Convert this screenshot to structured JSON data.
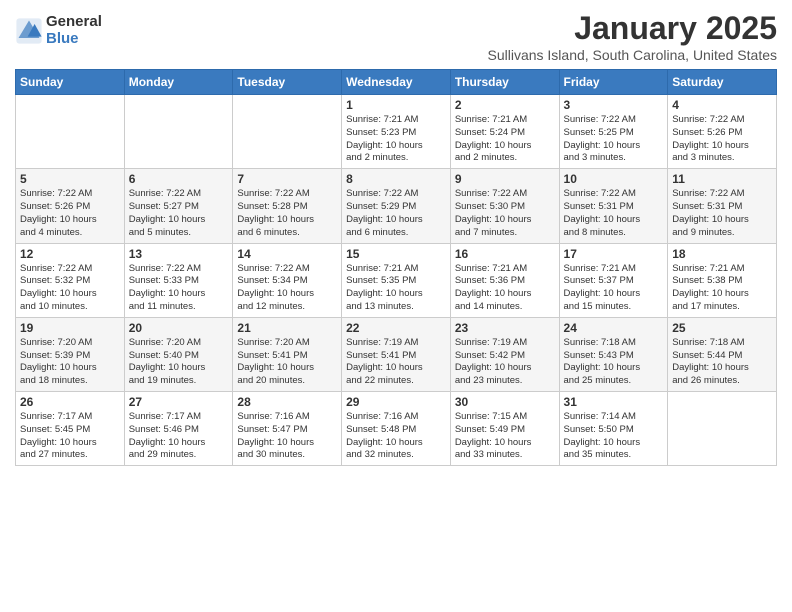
{
  "logo": {
    "general": "General",
    "blue": "Blue"
  },
  "title": "January 2025",
  "subtitle": "Sullivans Island, South Carolina, United States",
  "weekdays": [
    "Sunday",
    "Monday",
    "Tuesday",
    "Wednesday",
    "Thursday",
    "Friday",
    "Saturday"
  ],
  "weeks": [
    [
      {
        "day": "",
        "info": ""
      },
      {
        "day": "",
        "info": ""
      },
      {
        "day": "",
        "info": ""
      },
      {
        "day": "1",
        "info": "Sunrise: 7:21 AM\nSunset: 5:23 PM\nDaylight: 10 hours\nand 2 minutes."
      },
      {
        "day": "2",
        "info": "Sunrise: 7:21 AM\nSunset: 5:24 PM\nDaylight: 10 hours\nand 2 minutes."
      },
      {
        "day": "3",
        "info": "Sunrise: 7:22 AM\nSunset: 5:25 PM\nDaylight: 10 hours\nand 3 minutes."
      },
      {
        "day": "4",
        "info": "Sunrise: 7:22 AM\nSunset: 5:26 PM\nDaylight: 10 hours\nand 3 minutes."
      }
    ],
    [
      {
        "day": "5",
        "info": "Sunrise: 7:22 AM\nSunset: 5:26 PM\nDaylight: 10 hours\nand 4 minutes."
      },
      {
        "day": "6",
        "info": "Sunrise: 7:22 AM\nSunset: 5:27 PM\nDaylight: 10 hours\nand 5 minutes."
      },
      {
        "day": "7",
        "info": "Sunrise: 7:22 AM\nSunset: 5:28 PM\nDaylight: 10 hours\nand 6 minutes."
      },
      {
        "day": "8",
        "info": "Sunrise: 7:22 AM\nSunset: 5:29 PM\nDaylight: 10 hours\nand 6 minutes."
      },
      {
        "day": "9",
        "info": "Sunrise: 7:22 AM\nSunset: 5:30 PM\nDaylight: 10 hours\nand 7 minutes."
      },
      {
        "day": "10",
        "info": "Sunrise: 7:22 AM\nSunset: 5:31 PM\nDaylight: 10 hours\nand 8 minutes."
      },
      {
        "day": "11",
        "info": "Sunrise: 7:22 AM\nSunset: 5:31 PM\nDaylight: 10 hours\nand 9 minutes."
      }
    ],
    [
      {
        "day": "12",
        "info": "Sunrise: 7:22 AM\nSunset: 5:32 PM\nDaylight: 10 hours\nand 10 minutes."
      },
      {
        "day": "13",
        "info": "Sunrise: 7:22 AM\nSunset: 5:33 PM\nDaylight: 10 hours\nand 11 minutes."
      },
      {
        "day": "14",
        "info": "Sunrise: 7:22 AM\nSunset: 5:34 PM\nDaylight: 10 hours\nand 12 minutes."
      },
      {
        "day": "15",
        "info": "Sunrise: 7:21 AM\nSunset: 5:35 PM\nDaylight: 10 hours\nand 13 minutes."
      },
      {
        "day": "16",
        "info": "Sunrise: 7:21 AM\nSunset: 5:36 PM\nDaylight: 10 hours\nand 14 minutes."
      },
      {
        "day": "17",
        "info": "Sunrise: 7:21 AM\nSunset: 5:37 PM\nDaylight: 10 hours\nand 15 minutes."
      },
      {
        "day": "18",
        "info": "Sunrise: 7:21 AM\nSunset: 5:38 PM\nDaylight: 10 hours\nand 17 minutes."
      }
    ],
    [
      {
        "day": "19",
        "info": "Sunrise: 7:20 AM\nSunset: 5:39 PM\nDaylight: 10 hours\nand 18 minutes."
      },
      {
        "day": "20",
        "info": "Sunrise: 7:20 AM\nSunset: 5:40 PM\nDaylight: 10 hours\nand 19 minutes."
      },
      {
        "day": "21",
        "info": "Sunrise: 7:20 AM\nSunset: 5:41 PM\nDaylight: 10 hours\nand 20 minutes."
      },
      {
        "day": "22",
        "info": "Sunrise: 7:19 AM\nSunset: 5:41 PM\nDaylight: 10 hours\nand 22 minutes."
      },
      {
        "day": "23",
        "info": "Sunrise: 7:19 AM\nSunset: 5:42 PM\nDaylight: 10 hours\nand 23 minutes."
      },
      {
        "day": "24",
        "info": "Sunrise: 7:18 AM\nSunset: 5:43 PM\nDaylight: 10 hours\nand 25 minutes."
      },
      {
        "day": "25",
        "info": "Sunrise: 7:18 AM\nSunset: 5:44 PM\nDaylight: 10 hours\nand 26 minutes."
      }
    ],
    [
      {
        "day": "26",
        "info": "Sunrise: 7:17 AM\nSunset: 5:45 PM\nDaylight: 10 hours\nand 27 minutes."
      },
      {
        "day": "27",
        "info": "Sunrise: 7:17 AM\nSunset: 5:46 PM\nDaylight: 10 hours\nand 29 minutes."
      },
      {
        "day": "28",
        "info": "Sunrise: 7:16 AM\nSunset: 5:47 PM\nDaylight: 10 hours\nand 30 minutes."
      },
      {
        "day": "29",
        "info": "Sunrise: 7:16 AM\nSunset: 5:48 PM\nDaylight: 10 hours\nand 32 minutes."
      },
      {
        "day": "30",
        "info": "Sunrise: 7:15 AM\nSunset: 5:49 PM\nDaylight: 10 hours\nand 33 minutes."
      },
      {
        "day": "31",
        "info": "Sunrise: 7:14 AM\nSunset: 5:50 PM\nDaylight: 10 hours\nand 35 minutes."
      },
      {
        "day": "",
        "info": ""
      }
    ]
  ]
}
